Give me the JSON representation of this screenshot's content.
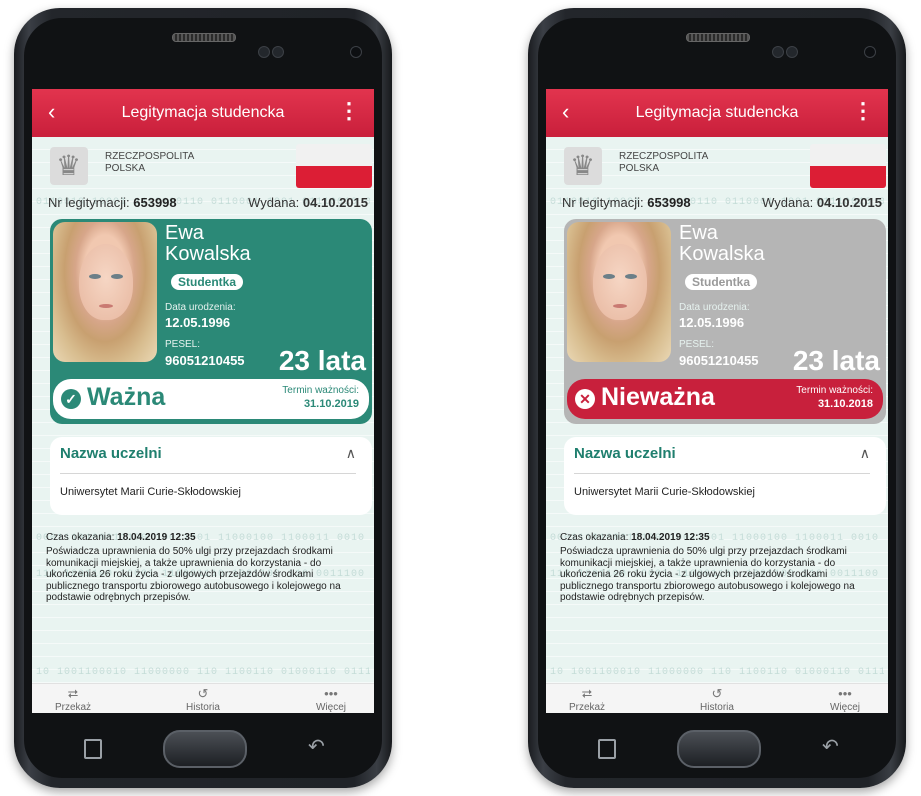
{
  "phones": [
    {
      "title": "Legitymacja studencka",
      "back_icon": "chevron-left-icon",
      "menu_icon": "kebab-menu-icon",
      "country_line1": "RZECZPOSPOLITA",
      "country_line2": "POLSKA",
      "id_label": "Nr legitymacji:",
      "id_number": "653998",
      "issued_label": "Wydana:",
      "issued_date": "04.10.2015",
      "first_name": "Ewa",
      "last_name": "Kowalska",
      "role": "Studentka",
      "dob_label": "Data urodzenia:",
      "dob": "12.05.1996",
      "pesel_label": "PESEL:",
      "pesel": "96051210455",
      "age": "23 lata",
      "status_icon": "check-circle-icon",
      "status": "Ważna",
      "expiry_label": "Termin ważności:",
      "expiry": "31.10.2019",
      "accent_color": "#2b8977",
      "university_header": "Nazwa uczelni",
      "university_name": "Uniwersytet Marii Curie-Skłodowskiej",
      "shown_time_label": "Czas okazania:",
      "shown_time": "18.04.2019 12:35",
      "note": "Poświadcza uprawnienia do 50% ulgi przy przejazdach środkami komunikacji miejskiej, a także uprawnienia do korzystania - do ukończenia 26 roku życia - z ulgowych przejazdów środkami publicznego transportu zbiorowego autobusowego i kolejowego na podstawie odrębnych przepisów.",
      "nav": [
        "Przekaż",
        "Historia",
        "Więcej"
      ]
    },
    {
      "title": "Legitymacja studencka",
      "back_icon": "chevron-left-icon",
      "menu_icon": "kebab-menu-icon",
      "country_line1": "RZECZPOSPOLITA",
      "country_line2": "POLSKA",
      "id_label": "Nr legitymacji:",
      "id_number": "653998",
      "issued_label": "Wydana:",
      "issued_date": "04.10.2015",
      "first_name": "Ewa",
      "last_name": "Kowalska",
      "role": "Studentka",
      "dob_label": "Data urodzenia:",
      "dob": "12.05.1996",
      "pesel_label": "PESEL:",
      "pesel": "96051210455",
      "age": "23 lata",
      "status_icon": "x-circle-icon",
      "status": "Nieważna",
      "expiry_label": "Termin ważności:",
      "expiry": "31.10.2018",
      "accent_color": "#c8203c",
      "university_header": "Nazwa uczelni",
      "university_name": "Uniwersytet Marii Curie-Skłodowskiej",
      "shown_time_label": "Czas okazania:",
      "shown_time": "18.04.2019 12:35",
      "note": "Poświadcza uprawnienia do 50% ulgi przy przejazdach środkami komunikacji miejskiej, a także uprawnienia do korzystania - do ukończenia 26 roku życia - z ulgowych przejazdów środkami publicznego transportu zbiorowego autobusowego i kolejowego na podstawie odrębnych przepisów.",
      "nav": [
        "Przekaż",
        "Historia",
        "Więcej"
      ]
    }
  ],
  "theme": {
    "header_red": "#d4253f",
    "valid_green": "#2b8977",
    "invalid_gray": "#b5b5b5"
  }
}
